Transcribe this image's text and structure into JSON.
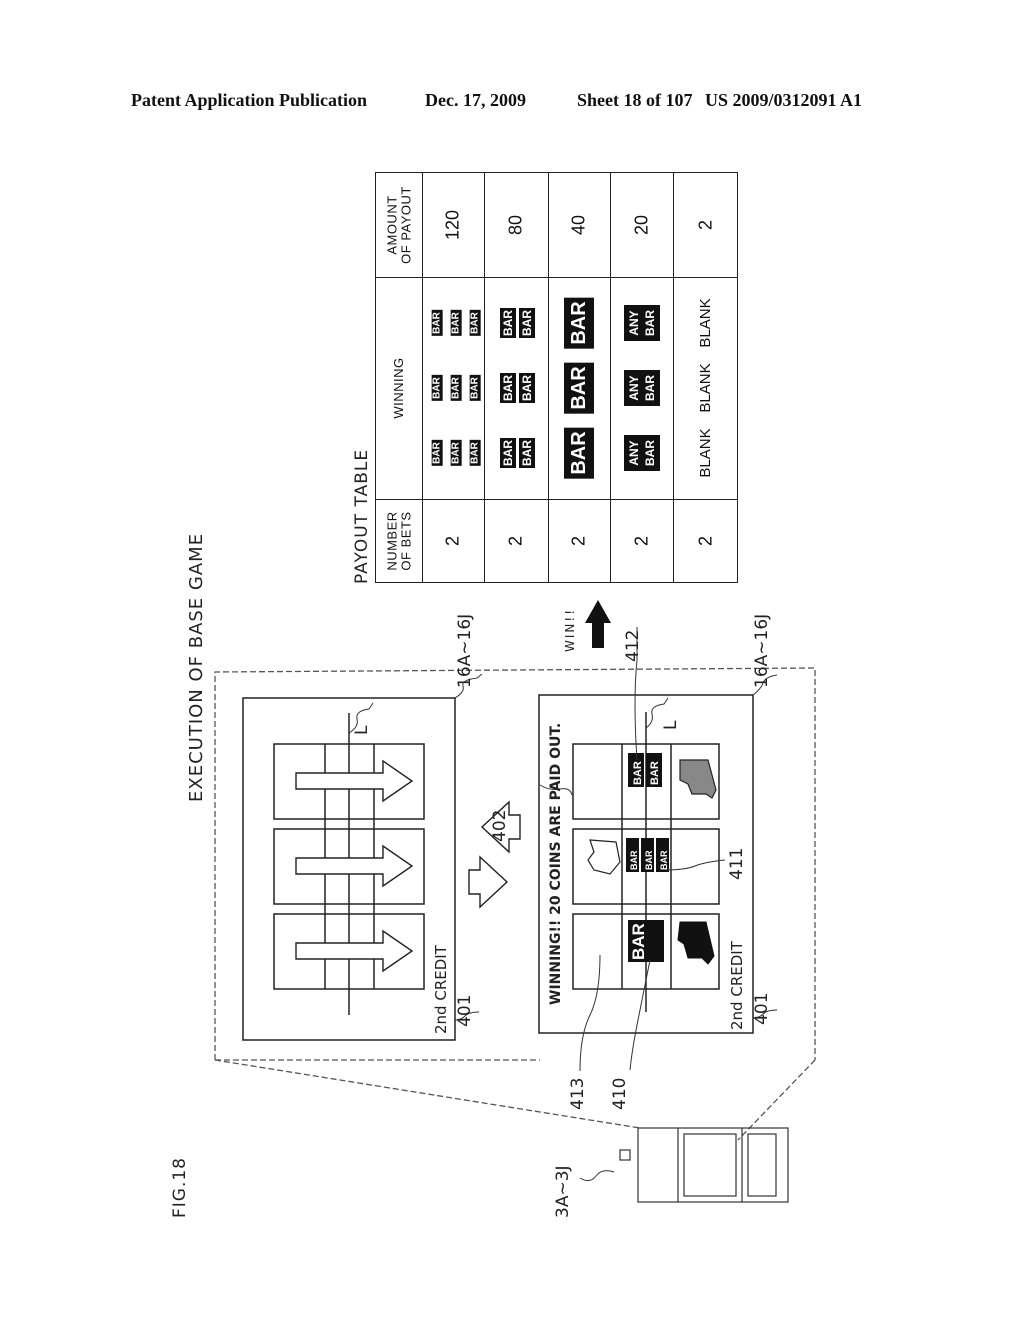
{
  "header": {
    "publication_type": "Patent Application Publication",
    "date": "Dec. 17, 2009",
    "sheet": "Sheet 18 of 107",
    "patent_number": "US 2009/0312091 A1"
  },
  "figure": {
    "label": "FIG.18",
    "title": "EXECUTION OF BASE GAME",
    "machine_ref": "3A~3J",
    "display_ref_top": "16A~16J",
    "display_ref_bottom": "16A~16J",
    "line_ref_top": "L",
    "line_ref_bottom": "L",
    "credit_text_top": "2nd CREDIT",
    "credit_text_bottom": "2nd CREDIT",
    "credit_ref_top": "401",
    "credit_ref_bottom": "401",
    "message_ref": "402",
    "winning_message": "WINNING!! 20 COINS ARE PAID OUT.",
    "win_arrow_label": "WIN!!",
    "symbol_refs": {
      "single_bar": "410",
      "triple_bar": "411",
      "double_bar": "412",
      "blank": "413"
    },
    "reel_symbols": {
      "reel1": [
        "BLANK",
        "BAR",
        "7 (black)"
      ],
      "reel2": [
        "7 (outline)",
        "BAR BAR BAR",
        "BLANK"
      ],
      "reel3": [
        "BLANK",
        "BAR BAR",
        "7 (hatched)"
      ]
    }
  },
  "payout_table": {
    "title": "PAYOUT TABLE",
    "columns": [
      "NUMBER OF BETS",
      "WINNING",
      "AMOUNT OF PAYOUT"
    ],
    "col_bets_line1": "NUMBER",
    "col_bets_line2": "OF BETS",
    "col_winning": "WINNING",
    "col_payout_line1": "AMOUNT",
    "col_payout_line2": "OF PAYOUT",
    "rows": [
      {
        "bets": "2",
        "winning": [
          "3BAR",
          "3BAR",
          "3BAR"
        ],
        "payout": "120"
      },
      {
        "bets": "2",
        "winning": [
          "2BAR",
          "2BAR",
          "2BAR"
        ],
        "payout": "80"
      },
      {
        "bets": "2",
        "winning": [
          "BAR",
          "BAR",
          "BAR"
        ],
        "payout": "40"
      },
      {
        "bets": "2",
        "winning": [
          "ANY BAR",
          "ANY BAR",
          "ANY BAR"
        ],
        "payout": "20"
      },
      {
        "bets": "2",
        "winning": [
          "BLANK",
          "BLANK",
          "BLANK"
        ],
        "payout": "2"
      }
    ],
    "symbol_bar": "BAR",
    "symbol_any": "ANY",
    "symbol_blank": "BLANK"
  }
}
